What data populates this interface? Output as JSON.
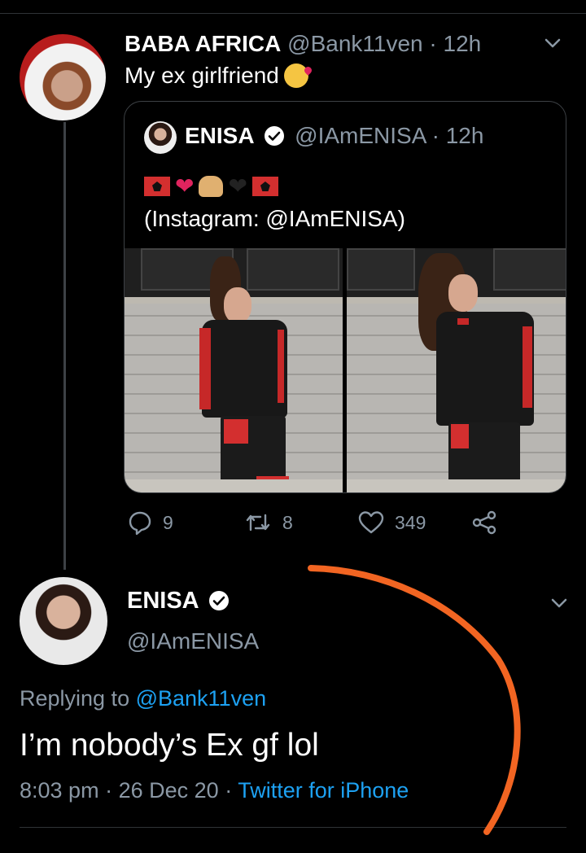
{
  "main_tweet": {
    "author_name": "BABA AFRICA",
    "handle": "@Bank11ven",
    "separator": "·",
    "time": "12h",
    "text": "My ex girlfriend",
    "emoji": "kissing-face-with-heart"
  },
  "quoted_tweet": {
    "author_name": "ENISA",
    "handle": "@IAmENISA",
    "separator": "·",
    "time": "12h",
    "emoji_row": [
      "albania-flag",
      "red-heart",
      "raising-hands",
      "black-heart",
      "albania-flag"
    ],
    "text": "(Instagram: @IAmENISA)"
  },
  "actions": {
    "replies": "9",
    "retweets": "8",
    "likes": "349"
  },
  "reply_tweet": {
    "author_name": "ENISA",
    "handle": "@IAmENISA",
    "replying_prefix": "Replying to",
    "replying_to": "@Bank11ven",
    "text": "I’m nobody’s Ex gf lol",
    "time": "8:03 pm",
    "sep1": "·",
    "date": "26 Dec 20",
    "sep2": "·",
    "source": "Twitter for iPhone"
  },
  "colors": {
    "background": "#000000",
    "muted_text": "#8b98a5",
    "link": "#1da1f2",
    "annotation": "#f26522",
    "verified_badge": "#ffffff"
  }
}
